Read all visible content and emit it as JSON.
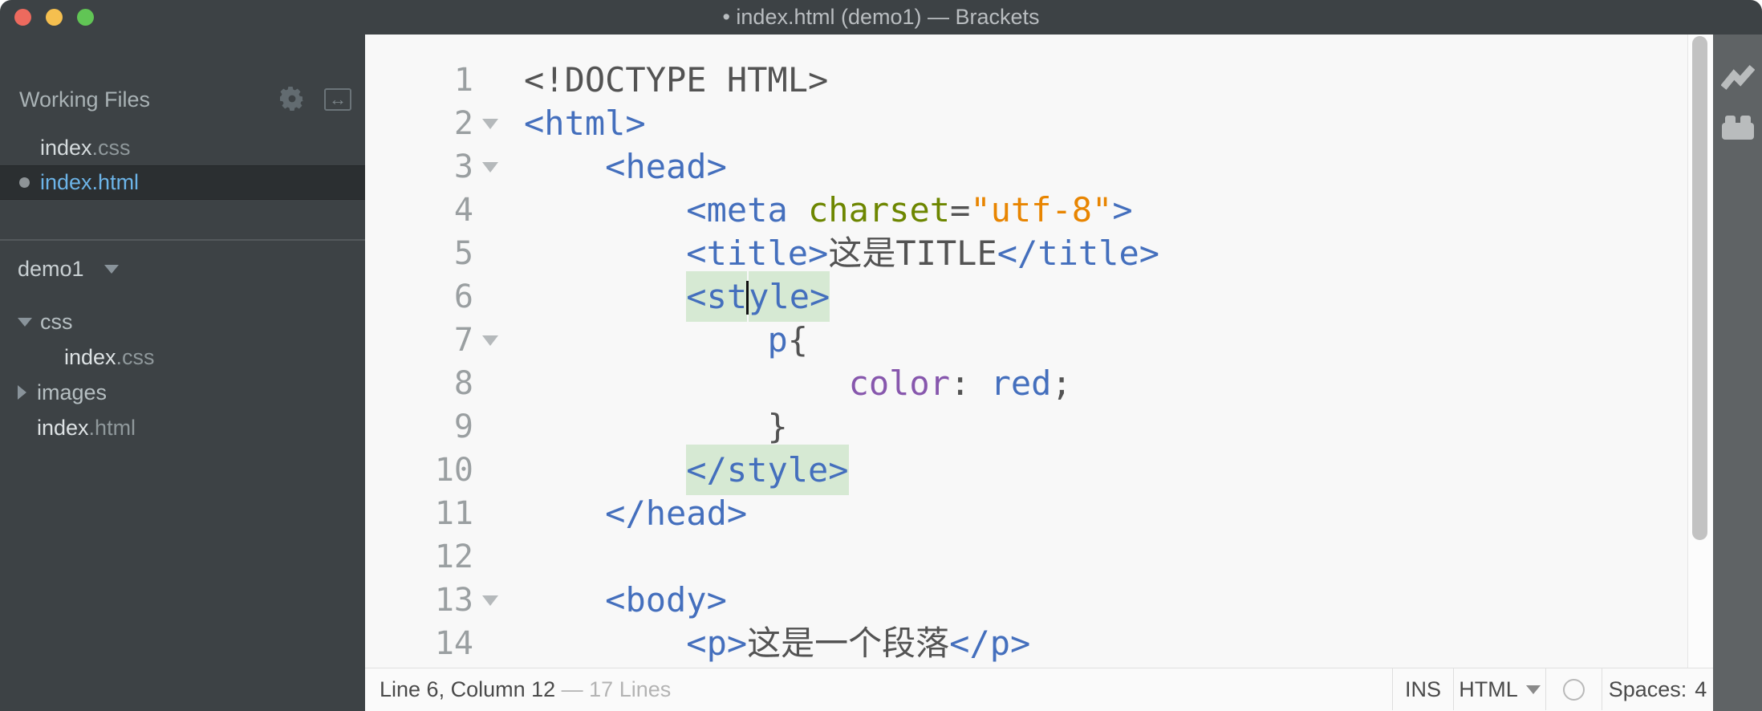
{
  "window": {
    "title": "• index.html (demo1) — Brackets"
  },
  "traffic_lights": {
    "close": "#ed6a5e",
    "minimize": "#f5bf4f",
    "zoom": "#61c555"
  },
  "sidebar": {
    "working_files": {
      "header": "Working Files",
      "items": [
        {
          "name": "index",
          "ext": ".css",
          "selected": false,
          "dirty": false
        },
        {
          "name": "index",
          "ext": ".html",
          "selected": true,
          "dirty": true
        }
      ]
    },
    "project": {
      "name": "demo1",
      "tree": [
        {
          "label": "css",
          "type": "folder",
          "state": "expanded"
        },
        {
          "name": "index",
          "ext": ".css",
          "type": "file"
        },
        {
          "label": "images",
          "type": "folder",
          "state": "collapsed"
        },
        {
          "name": "index",
          "ext": ".html",
          "type": "file"
        }
      ]
    }
  },
  "editor": {
    "colors": {
      "background": "#f8f8f8",
      "tag": "#446fbd",
      "attribute": "#6d8600",
      "string": "#e88501",
      "property": "#8757ad",
      "plain": "#535353",
      "line_number": "#9a9fa1",
      "match_highlight": "#d6e9d3"
    },
    "lines": [
      {
        "n": 1,
        "segs": [
          {
            "t": "<!DOCTYPE HTML>",
            "s": "plain"
          }
        ]
      },
      {
        "n": 2,
        "fold": true,
        "segs": [
          {
            "t": "<html>",
            "s": "tag"
          }
        ]
      },
      {
        "n": 3,
        "fold": true,
        "segs": [
          {
            "t": "    ",
            "s": "plain"
          },
          {
            "t": "<head>",
            "s": "tag"
          }
        ]
      },
      {
        "n": 4,
        "segs": [
          {
            "t": "        ",
            "s": "plain"
          },
          {
            "t": "<meta ",
            "s": "tag"
          },
          {
            "t": "charset",
            "s": "attr"
          },
          {
            "t": "=",
            "s": "plain"
          },
          {
            "t": "\"utf-8\"",
            "s": "string"
          },
          {
            "t": ">",
            "s": "tag"
          }
        ]
      },
      {
        "n": 5,
        "segs": [
          {
            "t": "        ",
            "s": "plain"
          },
          {
            "t": "<title>",
            "s": "tag"
          },
          {
            "t": "这是TITLE",
            "s": "plain"
          },
          {
            "t": "</title>",
            "s": "tag"
          }
        ]
      },
      {
        "n": 6,
        "segs": [
          {
            "t": "        ",
            "s": "plain"
          },
          {
            "t": "<st",
            "s": "tag",
            "hl": true
          },
          {
            "cursor": true
          },
          {
            "t": "yle>",
            "s": "tag",
            "hl": true
          }
        ]
      },
      {
        "n": 7,
        "fold": true,
        "segs": [
          {
            "t": "            ",
            "s": "plain"
          },
          {
            "t": "p",
            "s": "tag"
          },
          {
            "t": "{",
            "s": "plain"
          }
        ]
      },
      {
        "n": 8,
        "segs": [
          {
            "t": "                ",
            "s": "plain"
          },
          {
            "t": "color",
            "s": "prop"
          },
          {
            "t": ": ",
            "s": "plain"
          },
          {
            "t": "red",
            "s": "tag"
          },
          {
            "t": ";",
            "s": "plain"
          }
        ]
      },
      {
        "n": 9,
        "segs": [
          {
            "t": "            ",
            "s": "plain"
          },
          {
            "t": "}",
            "s": "plain"
          }
        ]
      },
      {
        "n": 10,
        "segs": [
          {
            "t": "        ",
            "s": "plain"
          },
          {
            "t": "</style>",
            "s": "tag",
            "hl": true
          }
        ]
      },
      {
        "n": 11,
        "segs": [
          {
            "t": "    ",
            "s": "plain"
          },
          {
            "t": "</head>",
            "s": "tag"
          }
        ]
      },
      {
        "n": 12,
        "segs": []
      },
      {
        "n": 13,
        "fold": true,
        "segs": [
          {
            "t": "    ",
            "s": "plain"
          },
          {
            "t": "<body>",
            "s": "tag"
          }
        ]
      },
      {
        "n": 14,
        "segs": [
          {
            "t": "        ",
            "s": "plain"
          },
          {
            "t": "<p>",
            "s": "tag"
          },
          {
            "t": "这是一个段落",
            "s": "plain"
          },
          {
            "t": "</p>",
            "s": "tag"
          }
        ]
      }
    ]
  },
  "statusbar": {
    "cursor_position": "Line 6, Column 12",
    "line_count": "— 17 Lines",
    "overwrite": "INS",
    "language": "HTML",
    "spaces_label": "Spaces:",
    "spaces_value": "4"
  }
}
